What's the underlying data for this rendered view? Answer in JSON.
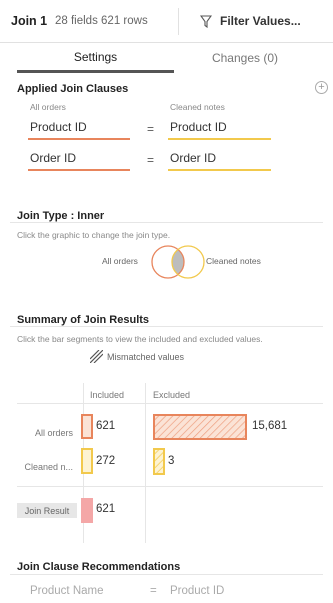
{
  "header": {
    "title": "Join 1",
    "meta": "28 fields  621 rows",
    "filter_label": "Filter Values..."
  },
  "tabs": [
    {
      "label": "Settings",
      "active": true
    },
    {
      "label": "Changes (0)",
      "active": false
    }
  ],
  "applied_join_clauses": {
    "title": "Applied Join Clauses",
    "left_source": "All orders",
    "right_source": "Cleaned notes",
    "operator": "=",
    "clauses": [
      {
        "left": "Product ID",
        "right": "Product ID"
      },
      {
        "left": "Order ID",
        "right": "Order ID"
      }
    ]
  },
  "join_type": {
    "title": "Join Type : Inner",
    "description": "Click the graphic to change the join type.",
    "left_label": "All orders",
    "right_label": "Cleaned notes"
  },
  "summary": {
    "title": "Summary of Join Results",
    "description": "Click the bar segments to view the included and excluded values.",
    "mismatched_label": "Mismatched values",
    "columns": {
      "included": "Included",
      "excluded": "Excluded"
    },
    "rows": [
      {
        "label": "All orders",
        "included": "621",
        "excluded": "15,681"
      },
      {
        "label": "Cleaned n...",
        "included": "272",
        "excluded": "3"
      }
    ],
    "join_result": {
      "label": "Join Result",
      "included": "621"
    }
  },
  "recommendations": {
    "title": "Join Clause Recommendations",
    "left": "Product Name",
    "operator": "=",
    "right": "Product ID"
  },
  "colors": {
    "left_source": "#e8855c",
    "right_source": "#f2c94c",
    "join_result": "#f4a7a7"
  }
}
